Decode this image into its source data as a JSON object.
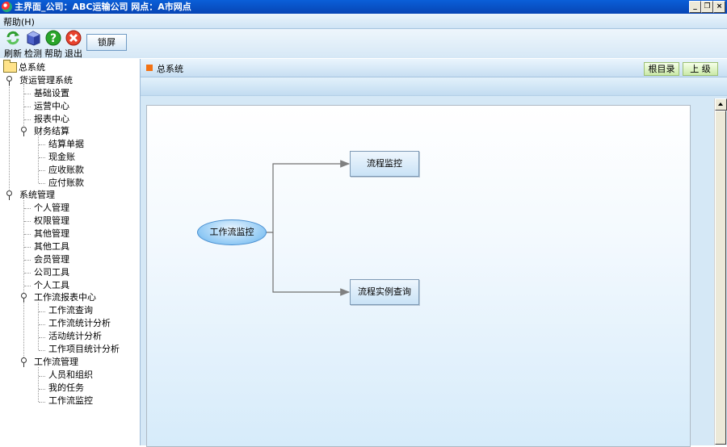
{
  "window": {
    "title": "主界面_公司：ABC运输公司  网点：A市网点"
  },
  "menu": {
    "help": "帮助(H)"
  },
  "toolbar": {
    "refresh": "刷新",
    "check": "检测",
    "help": "帮助",
    "exit": "退出",
    "lock": "锁屏",
    "icons": {
      "refresh": "refresh-icon",
      "check": "check-cube-icon",
      "help": "help-icon",
      "exit": "exit-icon"
    }
  },
  "tree": {
    "root": "总系统",
    "g1": "货运管理系统",
    "g1_items": [
      "基础设置",
      "运营中心",
      "报表中心"
    ],
    "g1_sub": "财务结算",
    "g1_sub_items": [
      "结算单据",
      "现金账",
      "应收账款",
      "应付账款"
    ],
    "g2": "系统管理",
    "g2_items": [
      "个人管理",
      "权限管理",
      "其他管理",
      "其他工具",
      "会员管理",
      "公司工具",
      "个人工具"
    ],
    "g2_sub1": "工作流报表中心",
    "g2_sub1_items": [
      "工作流查询",
      "工作流统计分析",
      "活动统计分析",
      "工作项目统计分析"
    ],
    "g2_sub2": "工作流管理",
    "g2_sub2_items": [
      "人员和组织",
      "我的任务",
      "工作流监控"
    ]
  },
  "content": {
    "breadcrumb": "总系统",
    "root_dir": "根目录",
    "up_level": "上 级",
    "flow": {
      "start": "工作流监控",
      "node1": "流程监控",
      "node2": "流程实例查询"
    }
  },
  "colors": {
    "title_bar": "#0a5fd8",
    "breadcrumb_marker": "#f37214"
  }
}
